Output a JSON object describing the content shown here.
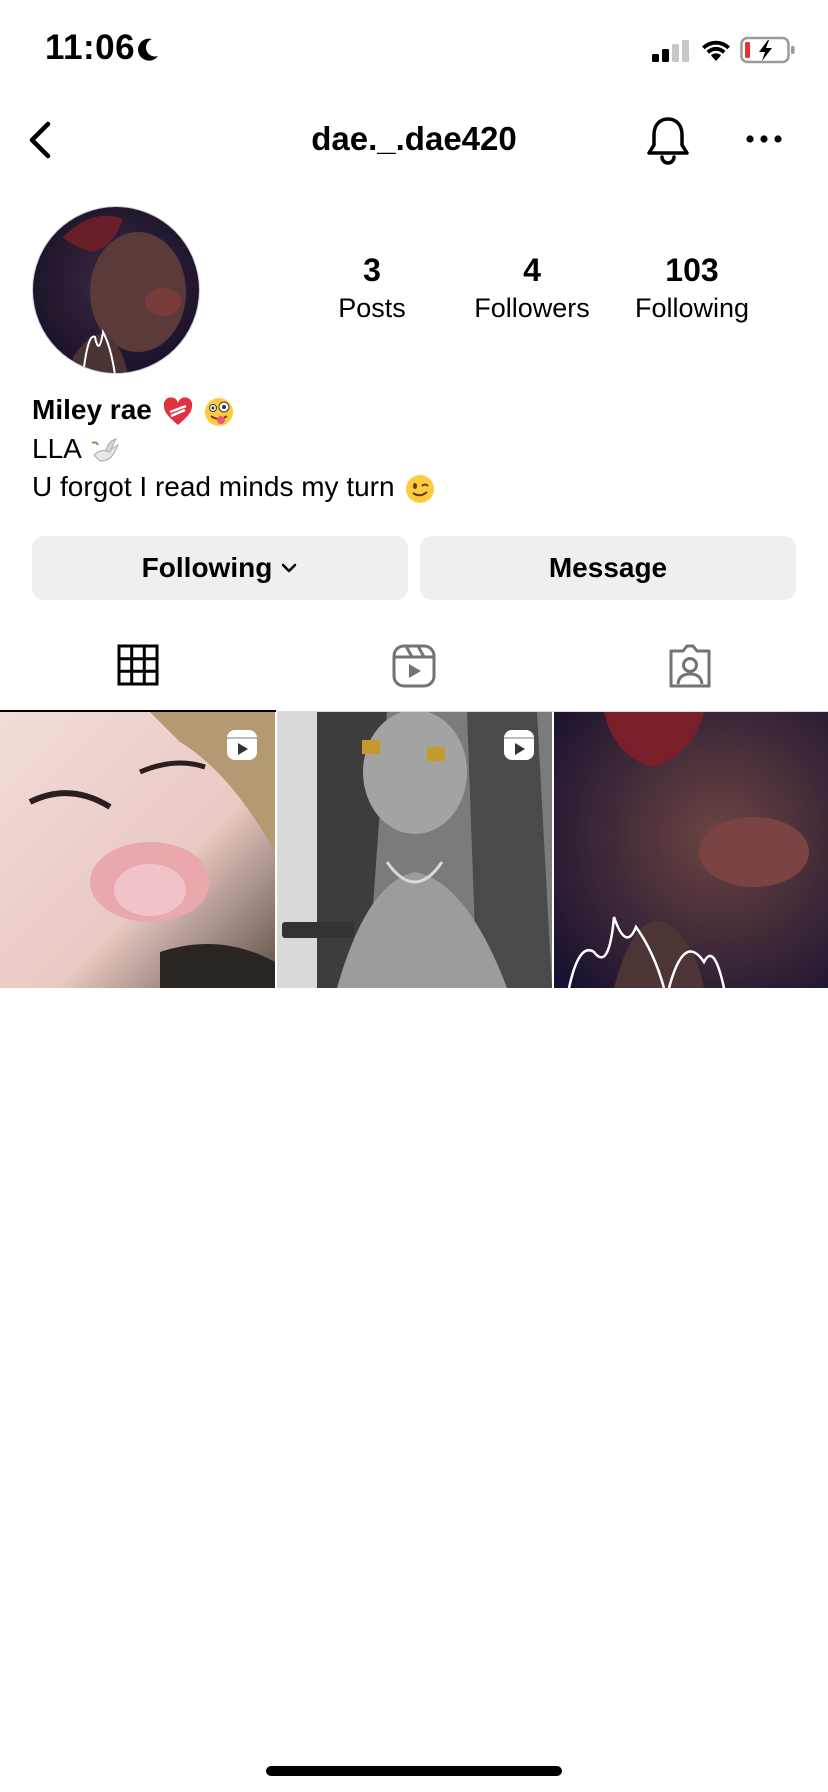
{
  "status_bar": {
    "time": "11:06"
  },
  "header": {
    "username": "dae._.dae420"
  },
  "profile": {
    "stats": [
      {
        "count": "3",
        "label": "Posts"
      },
      {
        "count": "4",
        "label": "Followers"
      },
      {
        "count": "103",
        "label": "Following"
      }
    ],
    "name": "Miley rae",
    "bio_line_1": "LLA",
    "bio_line_2": "U forgot I read minds my turn"
  },
  "actions": {
    "following_label": "Following",
    "message_label": "Message"
  },
  "tabs": [
    {
      "icon": "grid-icon",
      "active": true
    },
    {
      "icon": "reels-icon",
      "active": false
    },
    {
      "icon": "tagged-icon",
      "active": false
    }
  ],
  "posts": [
    {
      "type": "reel"
    },
    {
      "type": "reel"
    },
    {
      "type": "photo"
    }
  ],
  "colors": {
    "button_bg": "#efefef",
    "divider": "#dbdbdb",
    "text": "#000000"
  }
}
